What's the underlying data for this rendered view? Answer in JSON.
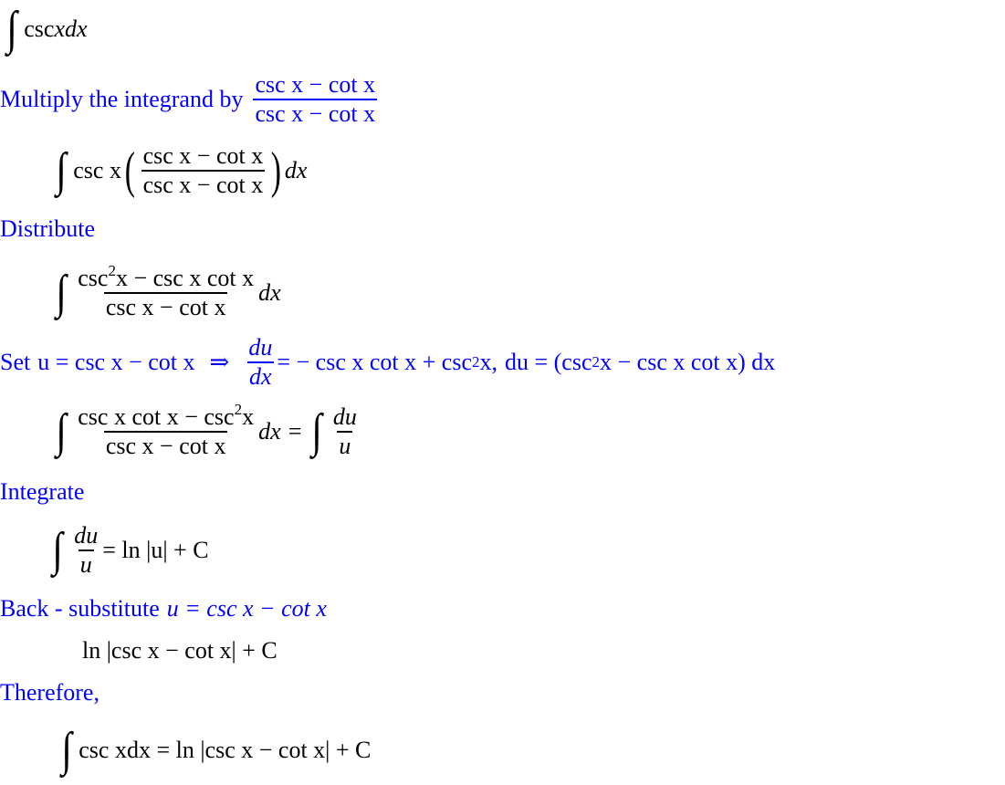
{
  "steps": {
    "problem": {
      "integral_sign": "∫",
      "integrand": "csc ",
      "var": "x",
      "dx": "dx"
    },
    "step1": {
      "label": "Multiply the integrand by",
      "frac_num": "csc x − cot x",
      "frac_den": "csc x − cot x"
    },
    "expr1": {
      "integral_sign": "∫",
      "prefix": "csc x",
      "open_paren": "(",
      "frac_num": "csc x − cot x",
      "frac_den": "csc x − cot x",
      "close_paren": ")",
      "suffix": "dx"
    },
    "step2": {
      "label": "Distribute"
    },
    "expr2": {
      "integral_sign": "∫",
      "num_a": "csc",
      "num_sup": "2",
      "num_b": "x − csc x cot x",
      "den": "csc x − cot x",
      "suffix": "dx"
    },
    "step3": {
      "label": "Set",
      "sub": "u = csc x − cot x",
      "arrow": "⇒",
      "deriv_num": "du",
      "deriv_den": "dx",
      "deriv_rhs_a": "= − csc x cot x + csc",
      "deriv_rhs_sup": "2",
      "deriv_rhs_b": "x,",
      "du_a": "du = (csc",
      "du_sup": "2",
      "du_b": "x − csc x cot x) dx"
    },
    "expr3": {
      "integral_sign": "∫",
      "num_a": "csc x cot x − csc",
      "num_sup": "2",
      "num_b": "x",
      "den": "csc x − cot x",
      "mid": "dx =",
      "integral_sign2": "∫",
      "rhs_num": "du",
      "rhs_den": "u"
    },
    "step4": {
      "label": "Integrate"
    },
    "expr4": {
      "integral_sign": "∫",
      "num": "du",
      "den": "u",
      "rhs": "= ln |u| + C"
    },
    "step5": {
      "label": "Back - substitute",
      "sub": "u = csc x − cot x"
    },
    "expr5": {
      "text": "ln |csc x − cot x| + C"
    },
    "step6": {
      "label": "Therefore,"
    },
    "expr6": {
      "integral_sign": "∫",
      "text": "csc xdx = ln |csc x − cot x| + C"
    }
  },
  "colors": {
    "annotation": "#0000ff",
    "math": "#000000"
  }
}
